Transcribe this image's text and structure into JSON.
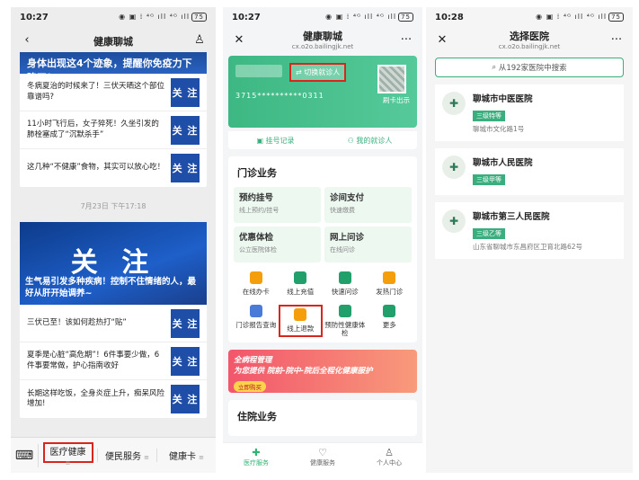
{
  "p1": {
    "time": "10:27",
    "status_icons": "◉ ▣ ⁞ ⁴ᴳ ıll ⁴ᴳ ıll",
    "battery": "75",
    "title": "健康聊城",
    "top_partial": "身体出现这4个迹象，提醒你免疫力下降了！",
    "articles_top": [
      {
        "text": "冬病夏治的时候来了！三伏天晒这个部位靠谱吗?",
        "thumb": "关 注"
      },
      {
        "text": "11小时飞行后，女子猝死！久坐引发的肺栓塞成了“沉默杀手”",
        "thumb": "关 注"
      },
      {
        "text": "这几种“不健康”食物，其实可以放心吃！",
        "thumb": "关 注"
      }
    ],
    "date": "7月23日 下午17:18",
    "banner_big": "关 注",
    "banner_caption": "生气易引发多种疾病！控制不住情绪的人，最好从肝开始调养~",
    "articles_bottom": [
      {
        "text": "三伏已至！该如何趁热打“贴”",
        "thumb": "关 注"
      },
      {
        "text": "夏季是心脏“高危期”！6件事要少做，6件事要常做，护心指南收好",
        "thumb": "关 注"
      },
      {
        "text": "长期这样吃饭，全身炎症上升，痴呆风险增加!",
        "thumb": "关 注"
      }
    ],
    "tabs": [
      "医疗健康",
      "便民服务",
      "健康卡"
    ]
  },
  "p2": {
    "time": "10:27",
    "battery": "75",
    "title": "健康聊城",
    "subtitle": "cx.o2o.bailingjk.net",
    "switch": "切换就诊人",
    "card_number": "3715**********0311",
    "qr_caption": "刷卡出示",
    "link_left": "挂号记录",
    "link_right": "我的就诊人",
    "section_title": "门诊业务",
    "tiles": [
      {
        "title": "预约挂号",
        "sub": "线上预约/挂号"
      },
      {
        "title": "诊间支付",
        "sub": "快速缴费"
      },
      {
        "title": "优惠体检",
        "sub": "公立医院体检"
      },
      {
        "title": "网上问诊",
        "sub": "在线问诊"
      }
    ],
    "services": [
      "在线办卡",
      "线上充值",
      "快速问诊",
      "发热门诊",
      "门诊报告查询",
      "线上退款",
      "预防性健康体检",
      "更多"
    ],
    "promo_l1": "全病程管理",
    "promo_l2": "为您提供 院前-院中-院后全程化健康服护",
    "promo_btn": "立即购买",
    "section2_title": "住院业务",
    "tabs": [
      "医疗服务",
      "健康服务",
      "个人中心"
    ]
  },
  "p3": {
    "time": "10:28",
    "battery": "75",
    "title": "选择医院",
    "subtitle": "cx.o2o.bailingjk.net",
    "search_placeholder": "从192家医院中搜索",
    "hospitals": [
      {
        "name": "聊城市中医医院",
        "level": "三级特等",
        "address": "聊城市文化路1号"
      },
      {
        "name": "聊城市人民医院",
        "level": "三级甲等",
        "address": ""
      },
      {
        "name": "聊城市第三人民医院",
        "level": "三级乙等",
        "address": "山东省聊城市东昌府区卫育北路62号"
      }
    ]
  }
}
